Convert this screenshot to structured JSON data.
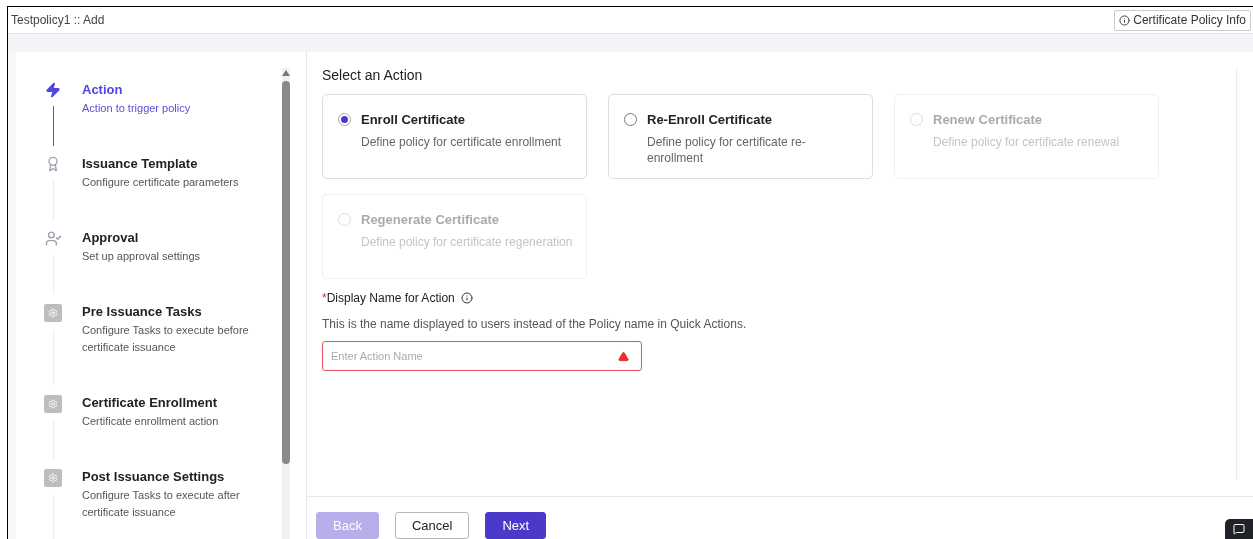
{
  "header": {
    "title": "Testpolicy1 :: Add",
    "info_button": "Certificate Policy Info"
  },
  "steps": [
    {
      "kind": "bolt",
      "title": "Action",
      "description": "Action to trigger policy",
      "selected": true
    },
    {
      "kind": "award",
      "title": "Issuance Template",
      "description": "Configure certificate parameters",
      "selected": false
    },
    {
      "kind": "user",
      "title": "Approval",
      "description": "Set up approval settings",
      "selected": false
    },
    {
      "kind": "gear",
      "title": "Pre Issuance Tasks",
      "description": "Configure Tasks to execute before certificate issuance",
      "selected": false
    },
    {
      "kind": "gear",
      "title": "Certificate Enrollment",
      "description": "Certificate enrollment action",
      "selected": false
    },
    {
      "kind": "gear",
      "title": "Post Issuance Settings",
      "description": "Configure Tasks to execute after certificate issuance",
      "selected": false
    }
  ],
  "section_title": "Select an Action",
  "actions": [
    {
      "title": "Enroll Certificate",
      "description": "Define policy for certificate enrollment",
      "selected": true,
      "disabled": false
    },
    {
      "title": "Re-Enroll Certificate",
      "description": "Define policy for certificate re-enrollment",
      "selected": false,
      "disabled": false
    },
    {
      "title": "Renew Certificate",
      "description": "Define policy for certificate renewal",
      "selected": false,
      "disabled": true
    },
    {
      "title": "Regenerate Certificate",
      "description": "Define policy for certificate regeneration",
      "selected": false,
      "disabled": true
    }
  ],
  "field": {
    "required_mark": "*",
    "label": "Display Name for Action",
    "help": "This is the name displayed to users instead of the Policy name in Quick Actions.",
    "placeholder": "Enter Action Name",
    "error": true
  },
  "buttons": [
    {
      "label": "Back",
      "kind": "secondary",
      "disabled": true
    },
    {
      "label": "Cancel",
      "kind": "outline",
      "disabled": false
    },
    {
      "label": "Next",
      "kind": "primary",
      "disabled": false
    }
  ]
}
